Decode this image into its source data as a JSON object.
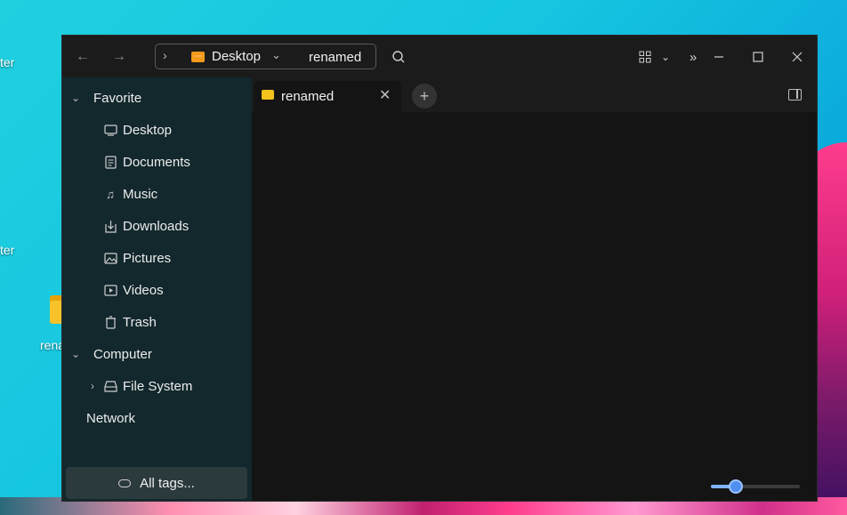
{
  "desktop": {
    "fragments": [
      "ter",
      "ter"
    ],
    "folder_label": "renamed"
  },
  "window": {
    "address": {
      "crumb": "Desktop",
      "current": "renamed"
    },
    "toolbar": {
      "back_icon": "arrow-left-icon",
      "forward_icon": "arrow-right-icon",
      "search_icon": "search-icon",
      "view_icon": "grid-view-icon",
      "more_icon": "double-chevron-icon",
      "minimize_icon": "minimize-icon",
      "maximize_icon": "maximize-icon",
      "close_icon": "close-icon"
    },
    "sidebar": {
      "favorite": "Favorite",
      "items": [
        {
          "label": "Desktop",
          "icon": "monitor-icon"
        },
        {
          "label": "Documents",
          "icon": "document-icon"
        },
        {
          "label": "Music",
          "icon": "music-icon"
        },
        {
          "label": "Downloads",
          "icon": "download-icon"
        },
        {
          "label": "Pictures",
          "icon": "picture-icon"
        },
        {
          "label": "Videos",
          "icon": "video-icon"
        },
        {
          "label": "Trash",
          "icon": "trash-icon"
        }
      ],
      "computer": "Computer",
      "filesystem": "File System",
      "network": "Network",
      "tags": "All tags..."
    },
    "tabs": [
      {
        "label": "renamed"
      }
    ],
    "zoom_level": 0.28,
    "colors": {
      "accent": "#4e8ff0",
      "sidebar_bg": "#13282d",
      "folder": "#f3c21c"
    }
  }
}
